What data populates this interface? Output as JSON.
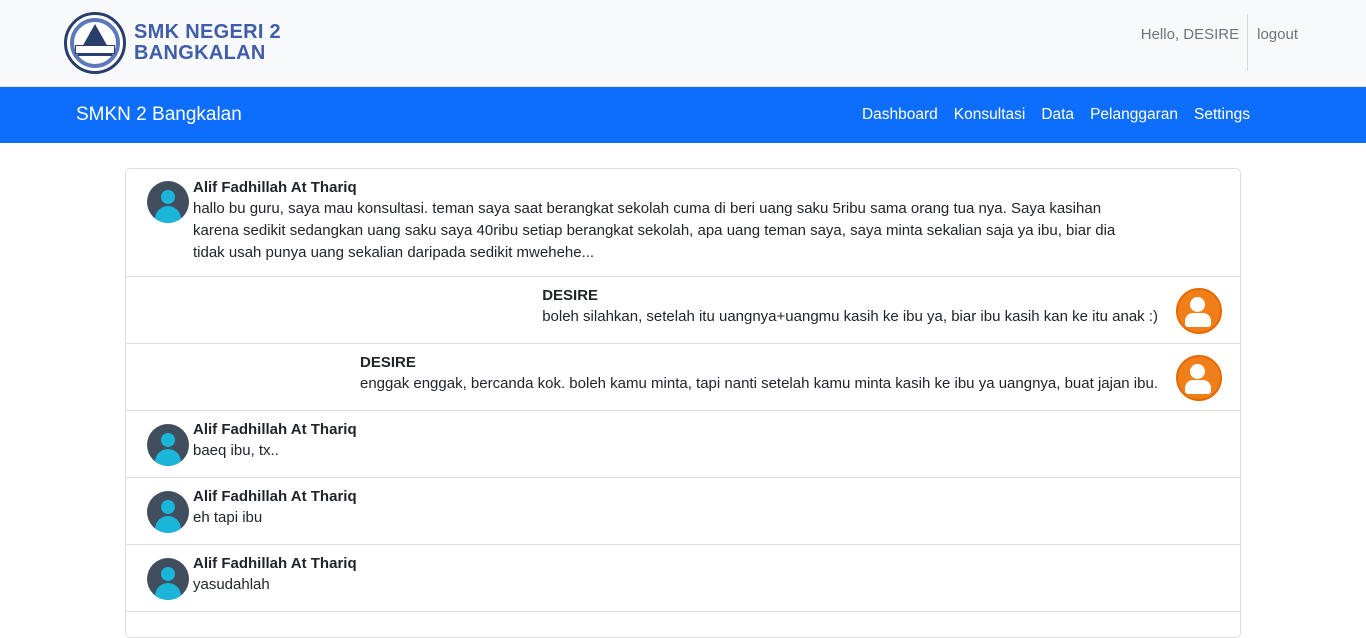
{
  "header": {
    "school_name_line1": "SMK NEGERI 2",
    "school_name_line2": "BANGKALAN",
    "greeting": "Hello, DESIRE",
    "logout_label": "logout"
  },
  "navbar": {
    "brand": "SMKN 2 Bangkalan",
    "menu": [
      "Dashboard",
      "Konsultasi",
      "Data",
      "Pelanggaran",
      "Settings"
    ]
  },
  "messages": [
    {
      "sender": "Alif Fadhillah At Thariq",
      "role": "student",
      "text": "hallo bu guru, saya mau konsultasi. teman saya saat berangkat sekolah cuma di beri uang saku 5ribu sama orang tua nya. Saya kasihan karena sedikit sedangkan uang saku saya 40ribu setiap berangkat sekolah, apa uang teman saya, saya minta sekalian saja ya ibu, biar dia tidak usah punya uang sekalian daripada sedikit mwehehe..."
    },
    {
      "sender": "DESIRE",
      "role": "teacher",
      "text": "boleh silahkan, setelah itu uangnya+uangmu kasih ke ibu ya, biar ibu kasih kan ke itu anak :)"
    },
    {
      "sender": "DESIRE",
      "role": "teacher",
      "text": "enggak enggak, bercanda kok. boleh kamu minta, tapi nanti setelah kamu minta kasih ke ibu ya uangnya, buat jajan ibu."
    },
    {
      "sender": "Alif Fadhillah At Thariq",
      "role": "student",
      "text": "baeq ibu, tx.."
    },
    {
      "sender": "Alif Fadhillah At Thariq",
      "role": "student",
      "text": "eh tapi ibu"
    },
    {
      "sender": "Alif Fadhillah At Thariq",
      "role": "student",
      "text": "yasudahlah"
    }
  ],
  "colors": {
    "navbar": "#0d6efd",
    "brand_text": "#3f5da8",
    "student_avatar": "#1ab5d9",
    "teacher_avatar": "#f07f1a"
  }
}
